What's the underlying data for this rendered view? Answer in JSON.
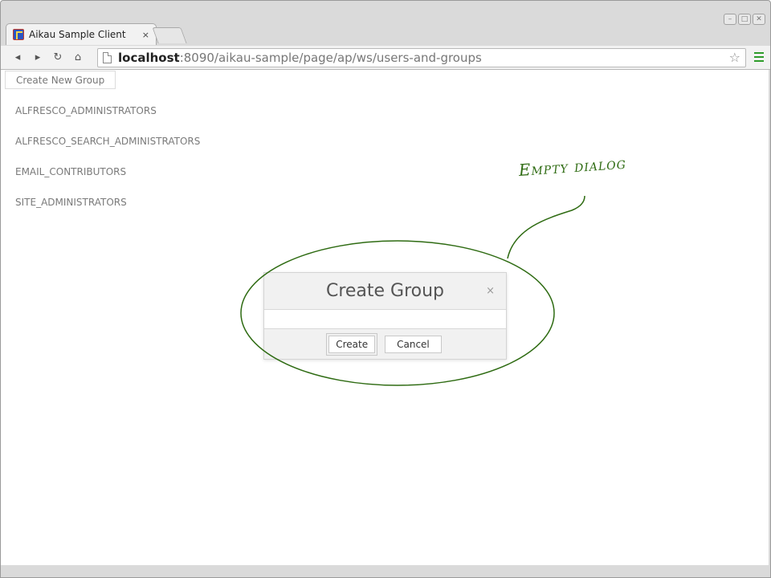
{
  "browser": {
    "tab": {
      "title": "Aikau Sample Client",
      "close_glyph": "×",
      "favicon": "aikau-favicon-icon"
    },
    "window_controls": {
      "minimize": "–",
      "maximize": "□",
      "close": "✕"
    },
    "toolbar": {
      "back_icon": "◂",
      "forward_icon": "▸",
      "reload_icon": "↻",
      "home_icon": "⌂",
      "url_host": "localhost",
      "url_rest": ":8090/aikau-sample/page/ap/ws/users-and-groups",
      "star_icon": "☆"
    }
  },
  "page": {
    "create_new_group_label": "Create New Group",
    "groups": [
      "ALFRESCO_ADMINISTRATORS",
      "ALFRESCO_SEARCH_ADMINISTRATORS",
      "EMAIL_CONTRIBUTORS",
      "SITE_ADMINISTRATORS"
    ]
  },
  "dialog": {
    "title": "Create Group",
    "close_glyph": "×",
    "create_label": "Create",
    "cancel_label": "Cancel"
  },
  "annotation": {
    "text": "Empty dialog",
    "color": "#2e6b12"
  }
}
